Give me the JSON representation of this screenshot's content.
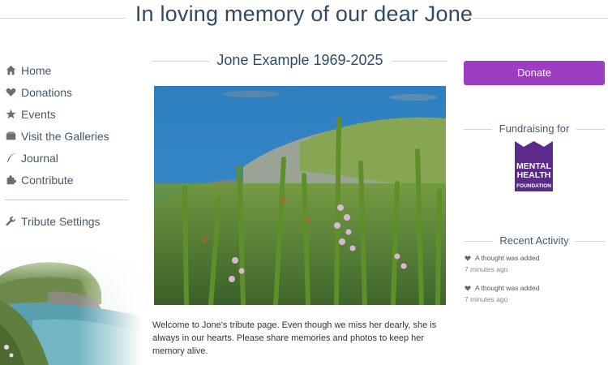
{
  "header": {
    "title": "In loving memory of our dear Jone"
  },
  "nav": {
    "items": [
      {
        "label": "Home",
        "icon": "home-icon"
      },
      {
        "label": "Donations",
        "icon": "heart-icon"
      },
      {
        "label": "Events",
        "icon": "star-icon"
      },
      {
        "label": "Visit the Galleries",
        "icon": "gallery-icon"
      },
      {
        "label": "Journal",
        "icon": "quill-icon"
      },
      {
        "label": "Contribute",
        "icon": "puzzle-icon"
      }
    ],
    "settings": {
      "label": "Tribute Settings",
      "icon": "wrench-icon"
    }
  },
  "main": {
    "subtitle": "Jone Example 1969-2025",
    "welcome": "Welcome to Jone's tribute page. Even though we miss her dearly, she is always in our hearts. Please share memories and photos to keep her memory alive."
  },
  "right": {
    "donate_label": "Donate",
    "fundraising_heading": "Fundraising for",
    "charity_logo_lines": [
      "MENTAL",
      "HEALTH",
      "FOUNDATION"
    ],
    "activity_heading": "Recent Activity",
    "activity": [
      {
        "text": "A thought was added",
        "time": "7 minutes ago"
      },
      {
        "text": "A thought was added",
        "time": "7 minutes ago"
      }
    ]
  },
  "colors": {
    "accent": "#9c3dc2",
    "heading": "#2f4a66",
    "nav_text": "#445a6e"
  }
}
